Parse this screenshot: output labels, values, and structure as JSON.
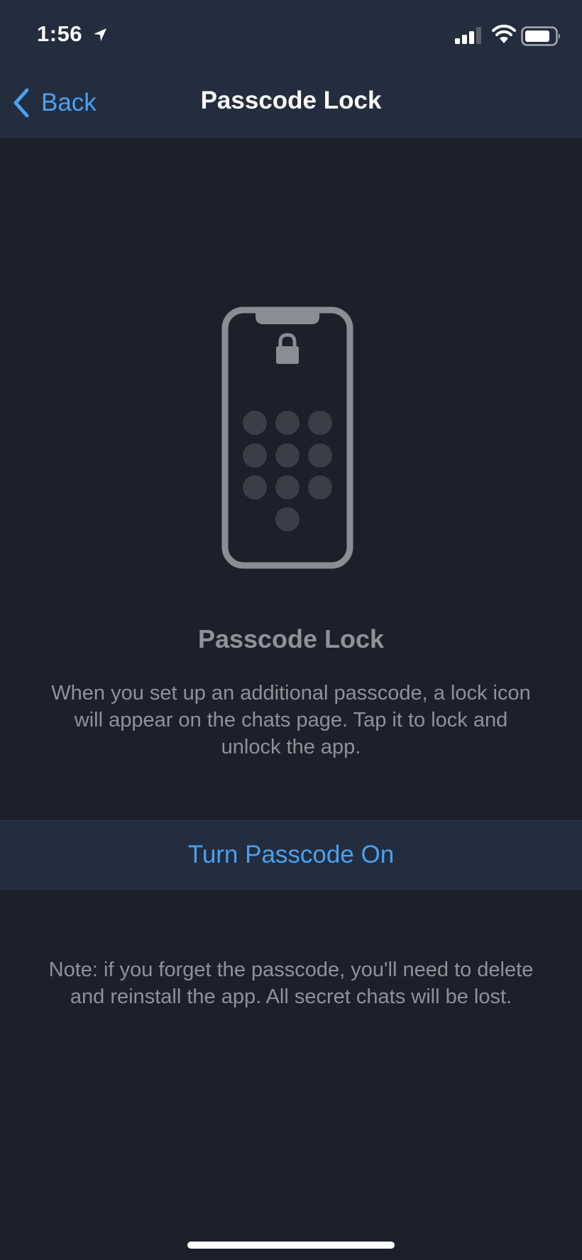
{
  "status_bar": {
    "time": "1:56",
    "icons": [
      "location-arrow-icon",
      "cellular-signal-icon",
      "wifi-icon",
      "battery-icon"
    ]
  },
  "nav": {
    "back_label": "Back",
    "title": "Passcode Lock"
  },
  "illustration": {
    "icon": "phone-lock-keypad-icon"
  },
  "content": {
    "heading": "Passcode Lock",
    "description": "When you set up an additional passcode, a lock icon will appear on the chats page. Tap it to lock and unlock the app.",
    "action_label": "Turn Passcode On",
    "note": "Note: if you forget the passcode, you'll need to delete and reinstall the app. All secret chats will be lost."
  },
  "colors": {
    "background": "#1b202b",
    "bar": "#232d3e",
    "accent": "#4aa0f0",
    "secondary_text": "#8e9299",
    "illustration": "#8a8d93",
    "dots": "#3a3e47"
  }
}
